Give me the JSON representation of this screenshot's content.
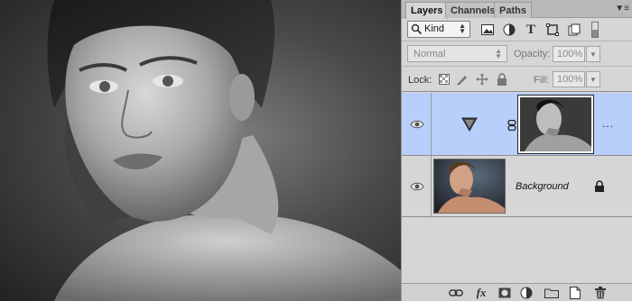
{
  "tabs": [
    {
      "label": "Layers",
      "active": true
    },
    {
      "label": "Channels",
      "active": false
    },
    {
      "label": "Paths",
      "active": false
    }
  ],
  "filter": {
    "kind_label": "Kind",
    "icons": [
      "pixel-layer-filter-icon",
      "adjustment-layer-filter-icon",
      "type-layer-filter-icon",
      "shape-layer-filter-icon",
      "smart-object-filter-icon"
    ]
  },
  "blend": {
    "mode": "Normal",
    "opacity_label": "Opacity:",
    "opacity_value": "100%",
    "lock_label": "Lock:",
    "fill_label": "Fill:",
    "fill_value": "100%"
  },
  "layers": [
    {
      "name": "",
      "type": "adjustment",
      "selected": true,
      "visible": true,
      "more": "..."
    },
    {
      "name": "Background",
      "type": "pixel",
      "selected": false,
      "visible": true,
      "locked": true
    }
  ],
  "footer_icons": [
    "link-layers-icon",
    "fx-icon",
    "add-mask-icon",
    "new-adjustment-icon",
    "new-group-icon",
    "new-layer-icon",
    "delete-layer-icon"
  ],
  "colors": {
    "selection": "#b8cffb",
    "panel": "#d6d6d6"
  }
}
